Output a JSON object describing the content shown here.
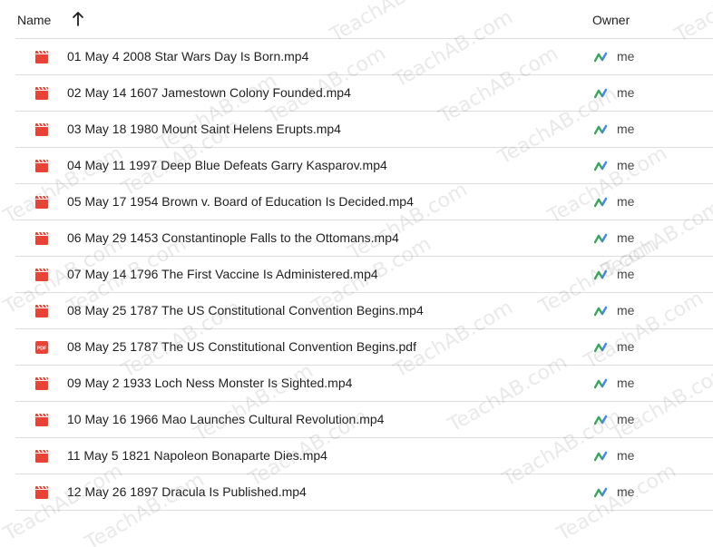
{
  "header": {
    "name_label": "Name",
    "owner_label": "Owner",
    "sort_icon": "arrow-up-icon"
  },
  "files": [
    {
      "name": "01 May 4 2008 Star Wars Day Is Born.mp4",
      "type": "video",
      "owner": "me"
    },
    {
      "name": "02 May 14 1607 Jamestown Colony Founded.mp4",
      "type": "video",
      "owner": "me"
    },
    {
      "name": "03 May 18 1980 Mount Saint Helens Erupts.mp4",
      "type": "video",
      "owner": "me"
    },
    {
      "name": "04 May 11 1997 Deep Blue Defeats Garry Kasparov.mp4",
      "type": "video",
      "owner": "me"
    },
    {
      "name": "05 May 17 1954 Brown v. Board of Education Is Decided.mp4",
      "type": "video",
      "owner": "me"
    },
    {
      "name": "06 May 29 1453 Constantinople Falls to the Ottomans.mp4",
      "type": "video",
      "owner": "me"
    },
    {
      "name": "07 May 14 1796 The First Vaccine Is Administered.mp4",
      "type": "video",
      "owner": "me"
    },
    {
      "name": "08 May 25 1787 The US Constitutional Convention Begins.mp4",
      "type": "video",
      "owner": "me"
    },
    {
      "name": "08 May 25 1787 The US Constitutional Convention Begins.pdf",
      "type": "pdf",
      "owner": "me"
    },
    {
      "name": "09 May 2 1933 Loch Ness Monster Is Sighted.mp4",
      "type": "video",
      "owner": "me"
    },
    {
      "name": "10 May 16 1966 Mao Launches Cultural Revolution.mp4",
      "type": "video",
      "owner": "me"
    },
    {
      "name": "11 May 5 1821 Napoleon Bonaparte Dies.mp4",
      "type": "video",
      "owner": "me"
    },
    {
      "name": "12 May 26 1897 Dracula Is Published.mp4",
      "type": "video",
      "owner": "me"
    }
  ],
  "icons": {
    "video": "video-file-icon",
    "pdf": "pdf-file-icon",
    "owner": "shared-drive-icon",
    "pdf_label": "PDF"
  },
  "colors": {
    "file_icon_red": "#ea4335",
    "owner_icon_green": "#34a853",
    "owner_icon_blue": "#4285f4",
    "divider": "#dadce0"
  },
  "watermark": {
    "text": "TeachAB.com"
  }
}
